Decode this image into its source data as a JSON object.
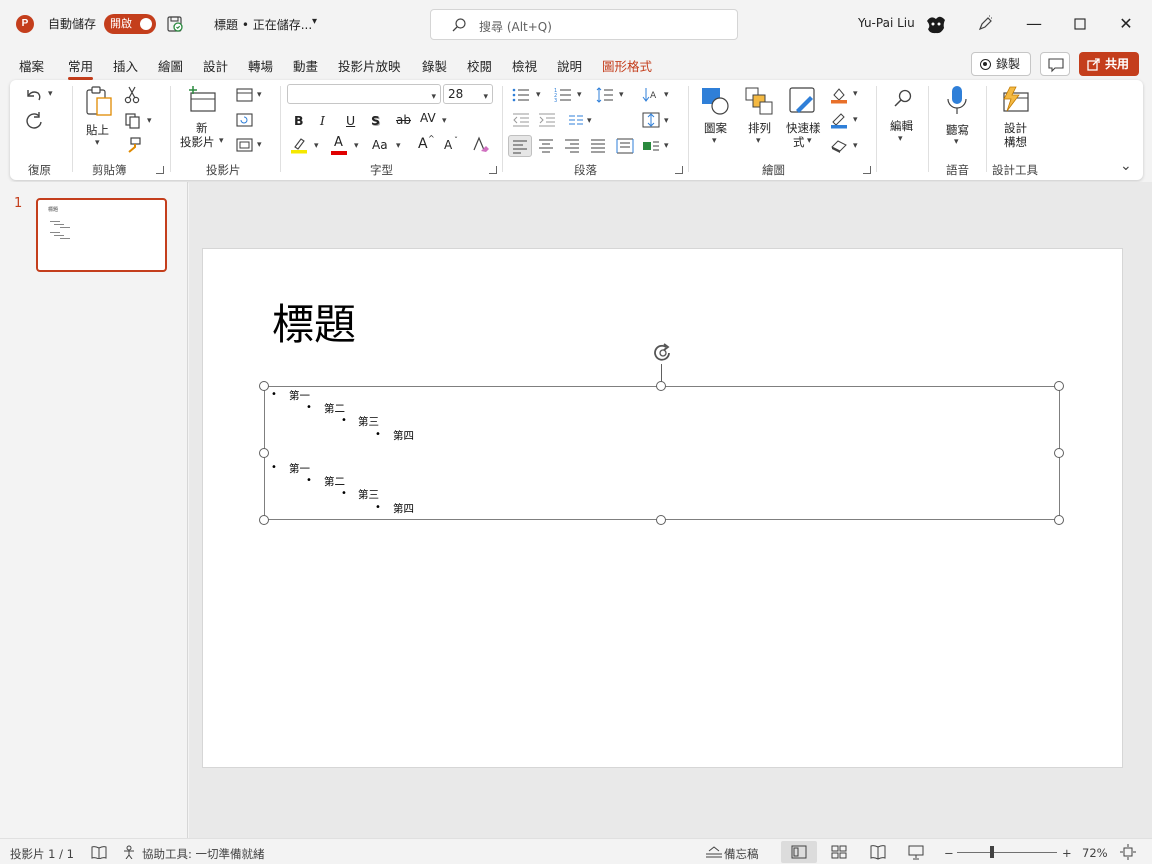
{
  "titlebar": {
    "app_logo": "P",
    "autosave_label": "自動儲存",
    "autosave_state": "開啟",
    "doc_title": "標題 • 正在儲存...",
    "search_placeholder": "搜尋 (Alt+Q)",
    "user_name": "Yu-Pai Liu"
  },
  "tabs": [
    "檔案",
    "常用",
    "插入",
    "繪圖",
    "設計",
    "轉場",
    "動畫",
    "投影片放映",
    "錄製",
    "校閱",
    "檢視",
    "說明",
    "圖形格式"
  ],
  "active_tab": "常用",
  "header_buttons": {
    "record": "錄製",
    "share": "共用"
  },
  "ribbon": {
    "groups": {
      "undo": "復原",
      "clipboard": "剪貼簿",
      "slides": "投影片",
      "font": "字型",
      "paragraph": "段落",
      "drawing": "繪圖",
      "voice": "語音",
      "designer": "設計工具"
    },
    "paste_label": "貼上",
    "new_slide_label_1": "新",
    "new_slide_label_2": "投影片",
    "font_name": "",
    "font_size": "28",
    "font_buttons": {
      "bold": "B",
      "italic": "I",
      "underline": "U",
      "shadow": "S",
      "strike": "ab",
      "spacing": "AV",
      "font_color": "A",
      "change_case": "Aa",
      "grow": "A",
      "shrink": "A"
    },
    "shapes_label": "圖案",
    "arrange_label": "排列",
    "quick_styles_label_1": "快速樣",
    "quick_styles_label_2": "式",
    "editing_label": "編輯",
    "dictate_label": "聽寫",
    "designer_label_1": "設計",
    "designer_label_2": "構想"
  },
  "thumbnail": {
    "number": "1",
    "title": "標題"
  },
  "slide": {
    "title": "標題",
    "bullets": [
      {
        "level": 1,
        "text": "第一"
      },
      {
        "level": 2,
        "text": "第二"
      },
      {
        "level": 3,
        "text": "第三"
      },
      {
        "level": 4,
        "text": "第四"
      },
      {
        "level": 1,
        "text": "第一"
      },
      {
        "level": 2,
        "text": "第二"
      },
      {
        "level": 3,
        "text": "第三"
      },
      {
        "level": 4,
        "text": "第四"
      }
    ]
  },
  "statusbar": {
    "slide_count": "投影片 1 / 1",
    "accessibility": "協助工具: 一切準備就緒",
    "notes": "備忘稿",
    "zoom_minus": "−",
    "zoom_plus": "+",
    "zoom": "72%"
  },
  "colors": {
    "accent": "#c43e1c",
    "ribbon_bg": "#ffffff",
    "chrome_bg": "#f3f3f3",
    "highlight_yellow": "#f5e800",
    "font_red": "#e00000",
    "shape_blue": "#2f7fd8"
  }
}
